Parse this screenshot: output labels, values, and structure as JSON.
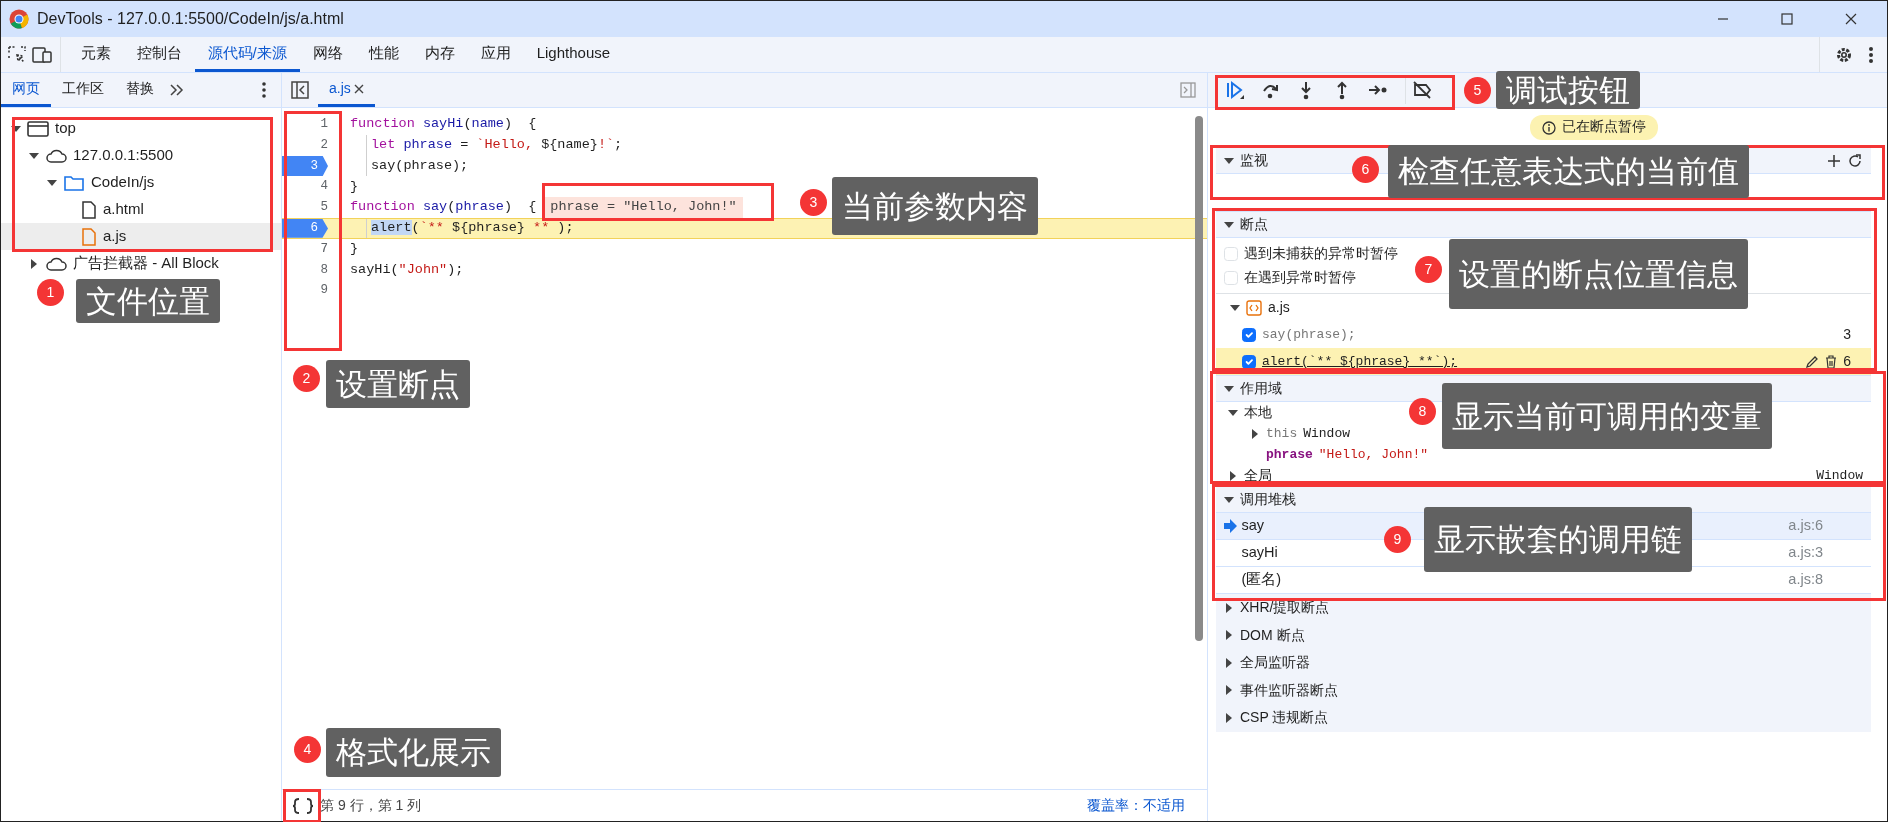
{
  "window": {
    "title": "DevTools - 127.0.0.1:5500/CodeIn/js/a.html"
  },
  "panel_tabs": [
    {
      "label": "元素",
      "selected": false
    },
    {
      "label": "控制台",
      "selected": false
    },
    {
      "label": "源代码/来源",
      "selected": true
    },
    {
      "label": "网络",
      "selected": false
    },
    {
      "label": "性能",
      "selected": false
    },
    {
      "label": "内存",
      "selected": false
    },
    {
      "label": "应用",
      "selected": false
    },
    {
      "label": "Lighthouse",
      "selected": false
    }
  ],
  "navigator": {
    "tabs": [
      {
        "label": "网页",
        "selected": true
      },
      {
        "label": "工作区",
        "selected": false
      },
      {
        "label": "替换",
        "selected": false
      }
    ],
    "tree": [
      {
        "label": "top",
        "kind": "frame",
        "expanded": true,
        "selected": false,
        "children": [
          {
            "label": "127.0.0.1:5500",
            "kind": "origin",
            "expanded": true,
            "selected": false,
            "children": [
              {
                "label": "CodeIn/js",
                "kind": "folder",
                "expanded": true,
                "selected": false,
                "children": [
                  {
                    "label": "a.html",
                    "kind": "file",
                    "selected": false
                  },
                  {
                    "label": "a.js",
                    "kind": "script",
                    "selected": true
                  }
                ]
              }
            ]
          },
          {
            "label": "广告拦截器 - All Block",
            "kind": "origin",
            "expanded": false,
            "selected": false
          }
        ]
      }
    ]
  },
  "editor": {
    "tabs": [
      {
        "label": "a.js",
        "selected": true
      }
    ],
    "lines": [
      {
        "number": "1",
        "breakpoint": false,
        "current": false,
        "indented": false,
        "tokens": [
          {
            "kind": "keyword",
            "text": "function"
          },
          {
            "kind": "def",
            "text": " sayHi"
          },
          {
            "kind": "plain",
            "text": "("
          },
          {
            "kind": "variable",
            "text": "name"
          },
          {
            "kind": "plain",
            "text": ")  {"
          }
        ]
      },
      {
        "number": "2",
        "breakpoint": false,
        "current": false,
        "indented": true,
        "tokens": [
          {
            "kind": "keyword",
            "text": "let"
          },
          {
            "kind": "variable",
            "text": " phrase"
          },
          {
            "kind": "plain",
            "text": " = "
          },
          {
            "kind": "string",
            "text": "`Hello, "
          },
          {
            "kind": "plain",
            "text": "${name}"
          },
          {
            "kind": "string",
            "text": "!`"
          },
          {
            "kind": "plain",
            "text": ";"
          }
        ]
      },
      {
        "number": "3",
        "breakpoint": true,
        "current": false,
        "indented": true,
        "tokens": [
          {
            "kind": "plain",
            "text": "say(phrase);"
          }
        ]
      },
      {
        "number": "4",
        "breakpoint": false,
        "current": false,
        "indented": false,
        "tokens": [
          {
            "kind": "plain",
            "text": "}"
          }
        ]
      },
      {
        "number": "5",
        "breakpoint": false,
        "current": false,
        "indented": false,
        "tokens": [
          {
            "kind": "keyword",
            "text": "function"
          },
          {
            "kind": "def",
            "text": " say"
          },
          {
            "kind": "plain",
            "text": "("
          },
          {
            "kind": "variable",
            "text": "phrase"
          },
          {
            "kind": "plain",
            "text": ")  {"
          }
        ],
        "inline_value": "phrase = \"Hello, John!\""
      },
      {
        "number": "6",
        "breakpoint": true,
        "current": true,
        "indented": true,
        "tokens": [
          {
            "kind": "selected",
            "text": "alert"
          },
          {
            "kind": "plain",
            "text": "("
          },
          {
            "kind": "string",
            "text": "`**"
          },
          {
            "kind": "plain",
            "text": " ${phrase} "
          },
          {
            "kind": "string",
            "text": "**"
          },
          {
            "kind": "plain",
            "text": " );"
          }
        ]
      },
      {
        "number": "7",
        "breakpoint": false,
        "current": false,
        "indented": false,
        "tokens": [
          {
            "kind": "plain",
            "text": "}"
          }
        ]
      },
      {
        "number": "8",
        "breakpoint": false,
        "current": false,
        "indented": false,
        "tokens": [
          {
            "kind": "plain",
            "text": "sayHi("
          },
          {
            "kind": "string",
            "text": "\"John\""
          },
          {
            "kind": "plain",
            "text": ");"
          }
        ]
      },
      {
        "number": "9",
        "breakpoint": false,
        "current": false,
        "indented": false
      }
    ],
    "status": {
      "position": "第 9 行，第 1 列",
      "coverage": "覆盖率：不适用"
    }
  },
  "debugger": {
    "paused_message": "已在断点暂停",
    "watch": {
      "title": "监视",
      "expanded": true
    },
    "breakpoints": {
      "title": "断点",
      "expanded": true,
      "options": [
        {
          "label": "遇到未捕获的异常时暂停",
          "checked": false
        },
        {
          "label": "在遇到异常时暂停",
          "checked": false
        }
      ],
      "files": [
        {
          "label": "a.js",
          "expanded": true,
          "items": [
            {
              "code": "say(phrase);",
              "line": "3",
              "checked": true,
              "selected": false
            },
            {
              "code": "alert(`** ${phrase} **`);",
              "line": "6",
              "checked": true,
              "selected": true
            }
          ]
        }
      ]
    },
    "scope": {
      "title": "作用域",
      "expanded": true,
      "groups": [
        {
          "label": "本地",
          "expanded": true,
          "variables": [
            {
              "name": "this",
              "value": "Window",
              "kind": "object",
              "expanded": false
            },
            {
              "name": "phrase",
              "value": "\"Hello, John!\"",
              "kind": "string"
            }
          ]
        },
        {
          "label": "全局",
          "expanded": false,
          "value": "Window"
        }
      ]
    },
    "call_stack": {
      "title": "调用堆栈",
      "expanded": true,
      "frames": [
        {
          "name": "say",
          "location": "a.js:6",
          "selected": true
        },
        {
          "name": "sayHi",
          "location": "a.js:3",
          "selected": false
        },
        {
          "name": "(匿名)",
          "location": "a.js:8",
          "selected": false
        }
      ]
    },
    "collapsed_sections": [
      {
        "title": "XHR/提取断点",
        "expanded": false
      },
      {
        "title": "DOM 断点",
        "expanded": false
      },
      {
        "title": "全局监听器",
        "expanded": false
      },
      {
        "title": "事件监听器断点",
        "expanded": false
      },
      {
        "title": "CSP 违规断点",
        "expanded": false
      }
    ]
  },
  "annotations": [
    {
      "number": "1",
      "label": "文件位置"
    },
    {
      "number": "2",
      "label": "设置断点"
    },
    {
      "number": "3",
      "label": "当前参数内容"
    },
    {
      "number": "4",
      "label": "格式化展示"
    },
    {
      "number": "5",
      "label": "调试按钮"
    },
    {
      "number": "6",
      "label": "检查任意表达式的当前值"
    },
    {
      "number": "7",
      "label": "设置的断点位置信息"
    },
    {
      "number": "8",
      "label": "显示当前可调用的变量"
    },
    {
      "number": "9",
      "label": "显示嵌套的调用链"
    }
  ]
}
